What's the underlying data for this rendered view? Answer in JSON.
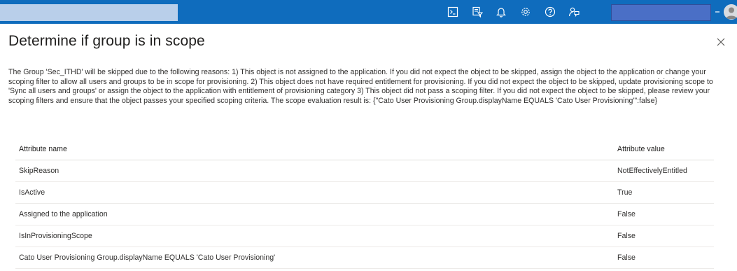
{
  "header": {
    "icons": [
      "cloud-shell-icon",
      "directory-filter-icon",
      "notifications-bell-icon",
      "settings-gear-icon",
      "help-question-icon",
      "feedback-icon"
    ],
    "colors": {
      "bar": "#0f6cbd"
    }
  },
  "panel": {
    "title": "Determine if group is in scope",
    "description": "The Group 'Sec_ITHD' will be skipped due to the following reasons: 1) This object is not assigned to the application. If you did not expect the object to be skipped, assign the object to the application or change your scoping filter to allow all users and groups to be in scope for provisioning. 2) This object does not have required entitlement for provisioning. If you did not expect the object to be skipped, update provisioning scope to 'Sync all users and groups' or assign the object to the application with entitlement of provisioning category 3) This object did not pass a scoping filter. If you did not expect the object to be skipped, please review your scoping filters and ensure that the object passes your specified scoping criteria. The scope evaluation result is: {\"Cato User Provisioning Group.displayName EQUALS 'Cato User Provisioning'\":false}"
  },
  "table": {
    "headers": {
      "name": "Attribute name",
      "value": "Attribute value"
    },
    "rows": [
      {
        "name": "SkipReason",
        "value": "NotEffectivelyEntitled"
      },
      {
        "name": "IsActive",
        "value": "True"
      },
      {
        "name": "Assigned to the application",
        "value": "False"
      },
      {
        "name": "IsInProvisioningScope",
        "value": "False"
      },
      {
        "name": "Cato User Provisioning Group.displayName EQUALS 'Cato User Provisioning'",
        "value": "False"
      }
    ]
  }
}
